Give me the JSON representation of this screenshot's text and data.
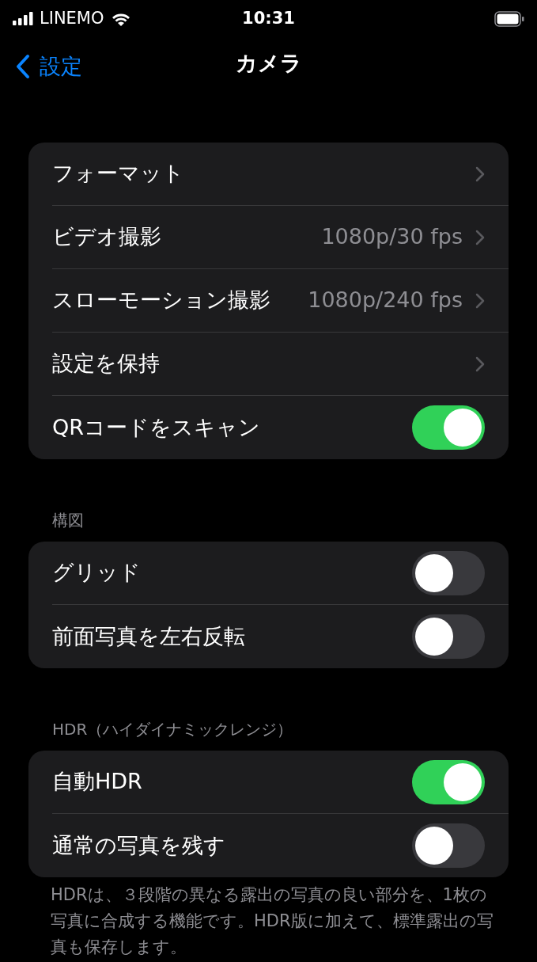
{
  "status_bar": {
    "carrier": "LINEMO",
    "time": "10:31"
  },
  "nav": {
    "back": "設定",
    "title": "カメラ"
  },
  "sections": [
    {
      "rows": [
        {
          "kind": "link",
          "label": "フォーマット"
        },
        {
          "kind": "link",
          "label": "ビデオ撮影",
          "value": "1080p/30 fps"
        },
        {
          "kind": "link",
          "label": "スローモーション撮影",
          "value": "1080p/240 fps"
        },
        {
          "kind": "link",
          "label": "設定を保持"
        },
        {
          "kind": "toggle",
          "label": "QRコードをスキャン",
          "on": true
        }
      ]
    },
    {
      "header": "構図",
      "rows": [
        {
          "kind": "toggle",
          "label": "グリッド",
          "on": false
        },
        {
          "kind": "toggle",
          "label": "前面写真を左右反転",
          "on": false
        }
      ]
    },
    {
      "header": "HDR（ハイダイナミックレンジ）",
      "rows": [
        {
          "kind": "toggle",
          "label": "自動HDR",
          "on": true
        },
        {
          "kind": "toggle",
          "label": "通常の写真を残す",
          "on": false
        }
      ],
      "footer": "HDRは、３段階の異なる露出の写真の良い部分を、1枚の写真に合成する機能です。HDR版に加えて、標準露出の写真も保存します。"
    }
  ]
}
